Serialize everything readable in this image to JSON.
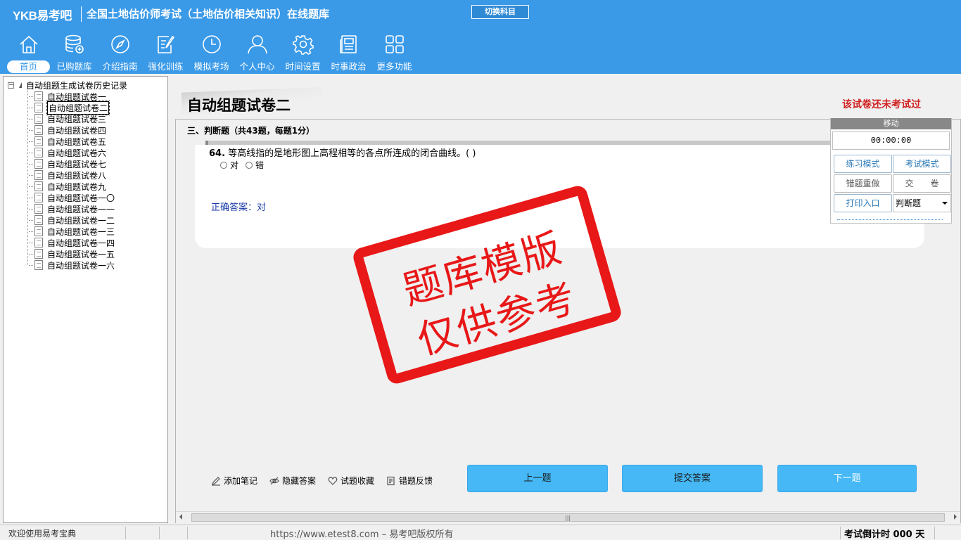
{
  "header": {
    "logo": "YKB易考吧",
    "title": "全国土地估价师考试（土地估价相关知识）在线题库",
    "switch_label": "切换科目"
  },
  "nav": [
    {
      "label": "首页",
      "icon": "home-icon"
    },
    {
      "label": "已购题库",
      "icon": "database-icon"
    },
    {
      "label": "介绍指南",
      "icon": "compass-icon"
    },
    {
      "label": "强化训练",
      "icon": "edit-icon"
    },
    {
      "label": "模拟考场",
      "icon": "clock-icon"
    },
    {
      "label": "个人中心",
      "icon": "user-icon"
    },
    {
      "label": "时间设置",
      "icon": "gear-icon"
    },
    {
      "label": "时事政治",
      "icon": "news-icon"
    },
    {
      "label": "更多功能",
      "icon": "grid-icon"
    }
  ],
  "tree": {
    "root": "自动组题生成试卷历史记录",
    "items": [
      "自动组题试卷一",
      "自动组题试卷二",
      "自动组题试卷三",
      "自动组题试卷四",
      "自动组题试卷五",
      "自动组题试卷六",
      "自动组题试卷七",
      "自动组题试卷八",
      "自动组题试卷九",
      "自动组题试卷一〇",
      "自动组题试卷一一",
      "自动组题试卷一二",
      "自动组题试卷一三",
      "自动组题试卷一四",
      "自动组题试卷一五",
      "自动组题试卷一六"
    ],
    "selected_index": 1
  },
  "main": {
    "paper_title": "自动组题试卷二",
    "status_note": "该试卷还未考试过",
    "section": "三、判断题（共43题，每题1分）",
    "question_number": "64.",
    "question_text": "等高线指的是地形图上高程相等的各点所连成的闭合曲线。( )",
    "options": [
      "对",
      "错"
    ],
    "answer_label": "正确答案：对"
  },
  "panel": {
    "move_label": "移动",
    "timer": "00:00:00",
    "practice_mode": "练习模式",
    "exam_mode": "考试模式",
    "redo_wrong": "错题重做",
    "hand_in": "交　　卷",
    "print_entry": "打印入口",
    "question_type": "判断题"
  },
  "stamp": {
    "line1": "题库模版",
    "line2": "仅供参考"
  },
  "tools": [
    {
      "label": "添加笔记",
      "icon": "pencil-icon"
    },
    {
      "label": "隐藏答案",
      "icon": "eye-icon"
    },
    {
      "label": "试题收藏",
      "icon": "heart-icon"
    },
    {
      "label": "错题反馈",
      "icon": "feedback-icon"
    }
  ],
  "buttons": {
    "prev": "上一题",
    "submit": "提交答案",
    "next": "下一题"
  },
  "status": {
    "welcome": "欢迎使用易考宝典",
    "copyright": "https://www.etest8.com – 易考吧版权所有",
    "countdown": "考试倒计时 000 天"
  }
}
